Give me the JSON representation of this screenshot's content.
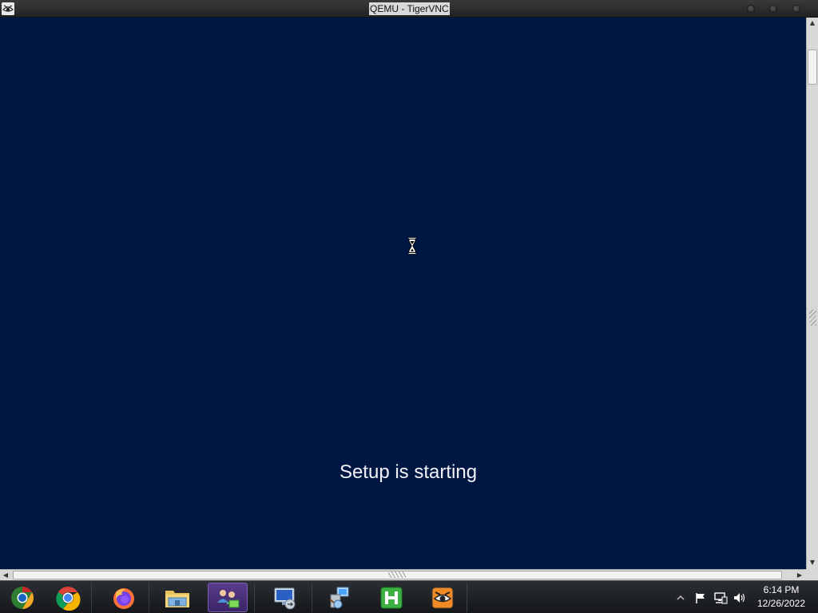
{
  "window": {
    "title": "QEMU - TigerVNC",
    "icon": "tigervnc-icon",
    "controls": [
      "minimize-button",
      "maximize-button",
      "close-button"
    ]
  },
  "screen": {
    "background_color": "#011743",
    "status_text": "Setup is starting",
    "cursor": "hourglass-busy-cursor"
  },
  "taskbar": {
    "pinned": [
      {
        "name": "chrome-canary-icon",
        "label": "Chromium"
      },
      {
        "name": "chrome-icon",
        "label": "Google Chrome"
      },
      {
        "name": "firefox-icon",
        "label": "Firefox"
      },
      {
        "name": "file-explorer-icon",
        "label": "File Explorer"
      },
      {
        "name": "network-users-icon",
        "label": "Users",
        "active": true
      },
      {
        "name": "remote-desktop-icon",
        "label": "Remote Desktop"
      },
      {
        "name": "installer-icon",
        "label": "Installer"
      },
      {
        "name": "h-app-icon",
        "label": "H"
      },
      {
        "name": "tigervnc-taskbar-icon",
        "label": "TigerVNC"
      }
    ],
    "tray": [
      "show-hidden-icons-icon",
      "action-center-flag-icon",
      "network-icon",
      "volume-icon"
    ],
    "clock": {
      "time": "6:14 PM",
      "date": "12/26/2022"
    }
  }
}
